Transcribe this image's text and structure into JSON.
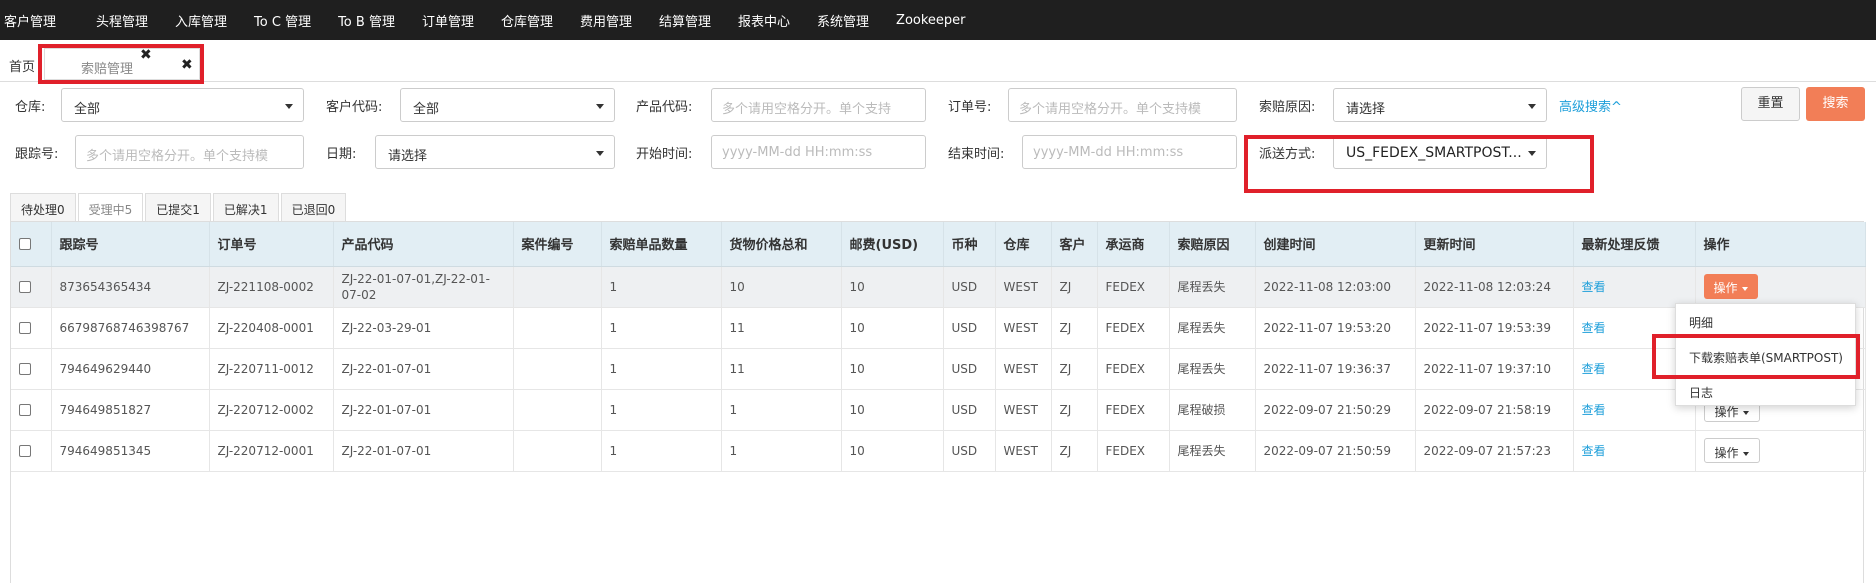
{
  "topnav": {
    "items": [
      "客户管理",
      "头程管理",
      "入库管理",
      "To C 管理",
      "To B 管理",
      "订单管理",
      "仓库管理",
      "费用管理",
      "结算管理",
      "报表中心",
      "系统管理",
      "Zookeeper"
    ]
  },
  "tabs": {
    "home_label": "首页",
    "current_label": "索赔管理",
    "close_glyph_1": "✖",
    "close_glyph_2": "✖"
  },
  "filters": {
    "warehouse_label": "仓库:",
    "warehouse_value": "全部",
    "customer_code_label": "客户代码:",
    "customer_code_value": "全部",
    "product_code_label": "产品代码:",
    "product_code_placeholder": "多个请用空格分开。单个支持",
    "order_no_label": "订单号:",
    "order_no_placeholder": "多个请用空格分开。单个支持模",
    "claim_reason_label": "索赔原因:",
    "claim_reason_value": "请选择",
    "advanced_search": "高级搜索^",
    "reset_label": "重置",
    "search_label": "搜索",
    "tracking_label": "跟踪号:",
    "tracking_placeholder": "多个请用空格分开。单个支持模",
    "date_label": "日期:",
    "date_value": "请选择",
    "start_time_label": "开始时间:",
    "start_time_placeholder": "yyyy-MM-dd HH:mm:ss",
    "end_time_label": "结束时间:",
    "end_time_placeholder": "yyyy-MM-dd HH:mm:ss",
    "delivery_label": "派送方式:",
    "delivery_value": "US_FEDEX_SMARTPOST..."
  },
  "status_tabs": [
    {
      "label": "待处理0"
    },
    {
      "label": "受理中5"
    },
    {
      "label": "已提交1"
    },
    {
      "label": "已解决1"
    },
    {
      "label": "已退回0"
    }
  ],
  "table": {
    "headers": [
      "跟踪号",
      "订单号",
      "产品代码",
      "案件编号",
      "索赔单品数量",
      "货物价格总和",
      "邮费(USD)",
      "币种",
      "仓库",
      "客户",
      "承运商",
      "索赔原因",
      "创建时间",
      "更新时间",
      "最新处理反馈",
      "操作"
    ],
    "view_label": "查看",
    "op_label": "操作",
    "rows": [
      {
        "tracking": "873654365434",
        "order": "ZJ-221108-0002",
        "product": "ZJ-22-01-07-01,ZJ-22-01-07-02",
        "case": "",
        "qty": "1",
        "total": "10",
        "postage": "10",
        "currency": "USD",
        "warehouse": "WEST",
        "customer": "ZJ",
        "carrier": "FEDEX",
        "reason": "尾程丢失",
        "created": "2022-11-08 12:03:00",
        "updated": "2022-11-08 12:03:24"
      },
      {
        "tracking": "66798768746398767",
        "order": "ZJ-220408-0001",
        "product": "ZJ-22-03-29-01",
        "case": "",
        "qty": "1",
        "total": "11",
        "postage": "10",
        "currency": "USD",
        "warehouse": "WEST",
        "customer": "ZJ",
        "carrier": "FEDEX",
        "reason": "尾程丢失",
        "created": "2022-11-07 19:53:20",
        "updated": "2022-11-07 19:53:39"
      },
      {
        "tracking": "794649629440",
        "order": "ZJ-220711-0012",
        "product": "ZJ-22-01-07-01",
        "case": "",
        "qty": "1",
        "total": "11",
        "postage": "10",
        "currency": "USD",
        "warehouse": "WEST",
        "customer": "ZJ",
        "carrier": "FEDEX",
        "reason": "尾程丢失",
        "created": "2022-11-07 19:36:37",
        "updated": "2022-11-07 19:37:10"
      },
      {
        "tracking": "794649851827",
        "order": "ZJ-220712-0002",
        "product": "ZJ-22-01-07-01",
        "case": "",
        "qty": "1",
        "total": "1",
        "postage": "10",
        "currency": "USD",
        "warehouse": "WEST",
        "customer": "ZJ",
        "carrier": "FEDEX",
        "reason": "尾程破损",
        "created": "2022-09-07 21:50:29",
        "updated": "2022-09-07 21:58:19"
      },
      {
        "tracking": "794649851345",
        "order": "ZJ-220712-0001",
        "product": "ZJ-22-01-07-01",
        "case": "",
        "qty": "1",
        "total": "1",
        "postage": "10",
        "currency": "USD",
        "warehouse": "WEST",
        "customer": "ZJ",
        "carrier": "FEDEX",
        "reason": "尾程丢失",
        "created": "2022-09-07 21:50:59",
        "updated": "2022-09-07 21:57:23"
      }
    ]
  },
  "dropdown": {
    "items": [
      "明细",
      "下载索赔表单(SMARTPOST)",
      "日志"
    ]
  },
  "colors": {
    "accent": "#f27e57",
    "link": "#1e9fda",
    "highlight": "#e0202a",
    "nav_bg": "#1f1f1f"
  }
}
